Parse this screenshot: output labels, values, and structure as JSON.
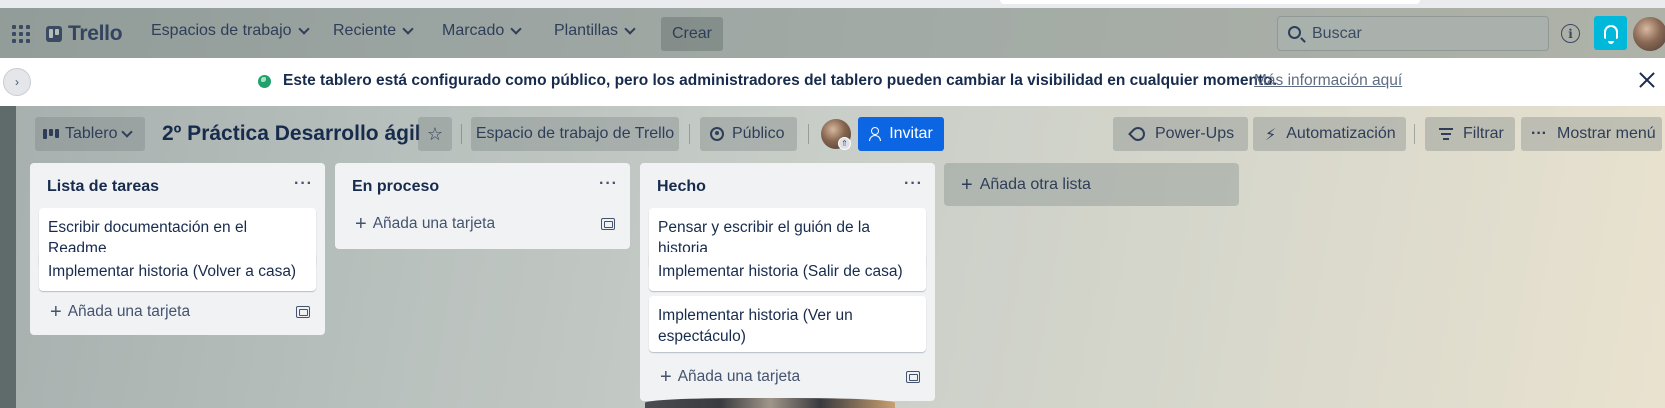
{
  "header": {
    "logo": "Trello",
    "nav": [
      {
        "label": "Espacios de trabajo"
      },
      {
        "label": "Reciente"
      },
      {
        "label": "Marcado"
      },
      {
        "label": "Plantillas"
      }
    ],
    "create_label": "Crear",
    "search_placeholder": "Buscar",
    "info_glyph": "i"
  },
  "banner": {
    "text": "Este tablero está configurado como público, pero los administradores del tablero pueden cambiar la visibilidad en cualquier momento.",
    "link": "Más información aquí",
    "collapse_glyph": "›"
  },
  "board": {
    "view_label": "Tablero",
    "title": "2º Práctica Desarrollo ágil",
    "star_glyph": "☆",
    "workspace_label": "Espacio de trabajo de Trello",
    "visibility_label": "Público",
    "invite_label": "Invitar",
    "powerups_label": "Power-Ups",
    "automation_label": "Automatización",
    "bolt_glyph": "⚡",
    "filter_label": "Filtrar",
    "menu_label": "Mostrar menú",
    "dots_glyph": "···"
  },
  "lists": [
    {
      "title": "Lista de tareas",
      "cards": [
        "Escribir documentación en el Readme",
        "Implementar historia (Volver a casa)"
      ],
      "add_card": "Añada una tarjeta"
    },
    {
      "title": "En proceso",
      "cards": [],
      "add_card": "Añada una tarjeta"
    },
    {
      "title": "Hecho",
      "cards": [
        "Pensar y escribir el guión de la historia",
        "Implementar historia (Salir de casa)",
        "Implementar historia (Ver un espectáculo)"
      ],
      "add_card": "Añada una tarjeta"
    }
  ],
  "list_menu_glyph": "···",
  "plus_glyph": "+",
  "add_list_label": "Añada otra lista",
  "icons": {
    "apps": "grid-icon",
    "search": "search-icon",
    "info": "info-icon",
    "notifications": "bell-icon",
    "visibility": "globe-icon",
    "close": "close-icon"
  },
  "colors": {
    "invite": "#0c66e4",
    "notification": "#00b8d9",
    "public_indicator": "#22a06b"
  }
}
